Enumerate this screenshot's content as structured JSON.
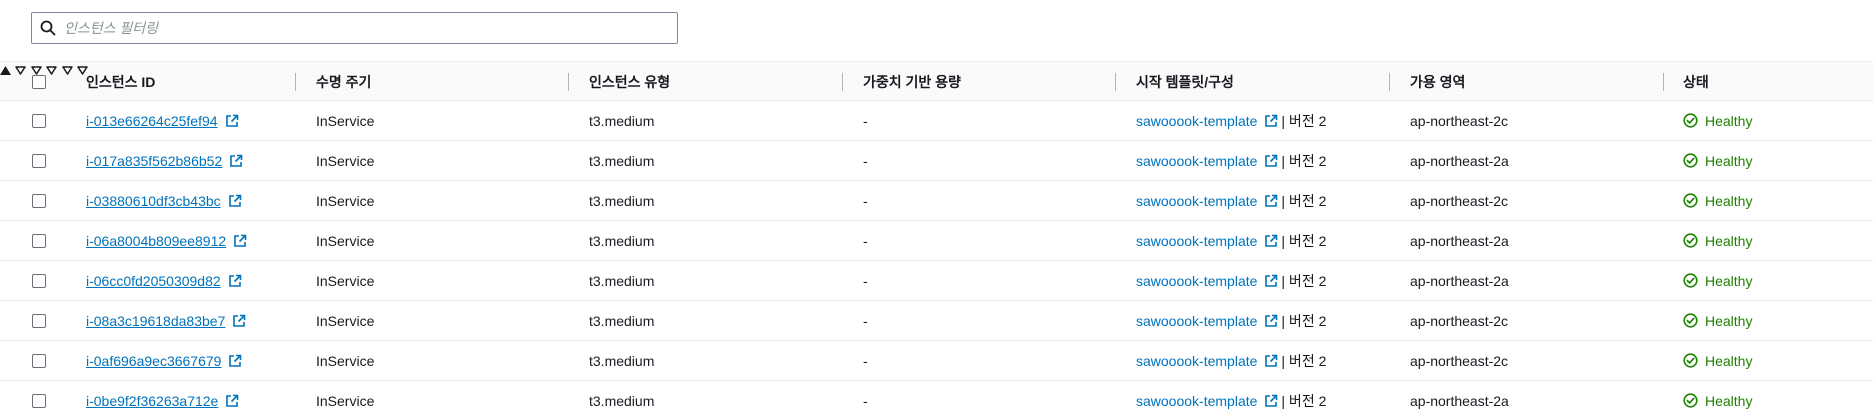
{
  "filter": {
    "placeholder": "인스턴스 필터링",
    "value": ""
  },
  "columns": [
    {
      "key": "id",
      "label": "인스턴스 ID",
      "sort": "ascending"
    },
    {
      "key": "lifecycle",
      "label": "수명 주기",
      "sort": "none"
    },
    {
      "key": "type",
      "label": "인스턴스 유형",
      "sort": "none"
    },
    {
      "key": "weight",
      "label": "가중치 기반 용량",
      "sort": "none"
    },
    {
      "key": "template",
      "label": "시작 템플릿/구성",
      "sort": "none"
    },
    {
      "key": "az",
      "label": "가용 영역",
      "sort": "none"
    },
    {
      "key": "health",
      "label": "상태",
      "sort": "none"
    }
  ],
  "rows": [
    {
      "id": "i-013e66264c25fef94",
      "lifecycle": "InService",
      "type": "t3.medium",
      "weight": "-",
      "template": "sawooook-template",
      "version": "| 버전 2",
      "az": "ap-northeast-2c",
      "health": "Healthy"
    },
    {
      "id": "i-017a835f562b86b52",
      "lifecycle": "InService",
      "type": "t3.medium",
      "weight": "-",
      "template": "sawooook-template",
      "version": "| 버전 2",
      "az": "ap-northeast-2a",
      "health": "Healthy"
    },
    {
      "id": "i-03880610df3cb43bc",
      "lifecycle": "InService",
      "type": "t3.medium",
      "weight": "-",
      "template": "sawooook-template",
      "version": "| 버전 2",
      "az": "ap-northeast-2c",
      "health": "Healthy"
    },
    {
      "id": "i-06a8004b809ee8912",
      "lifecycle": "InService",
      "type": "t3.medium",
      "weight": "-",
      "template": "sawooook-template",
      "version": "| 버전 2",
      "az": "ap-northeast-2a",
      "health": "Healthy"
    },
    {
      "id": "i-06cc0fd2050309d82",
      "lifecycle": "InService",
      "type": "t3.medium",
      "weight": "-",
      "template": "sawooook-template",
      "version": "| 버전 2",
      "az": "ap-northeast-2a",
      "health": "Healthy"
    },
    {
      "id": "i-08a3c19618da83be7",
      "lifecycle": "InService",
      "type": "t3.medium",
      "weight": "-",
      "template": "sawooook-template",
      "version": "| 버전 2",
      "az": "ap-northeast-2c",
      "health": "Healthy"
    },
    {
      "id": "i-0af696a9ec3667679",
      "lifecycle": "InService",
      "type": "t3.medium",
      "weight": "-",
      "template": "sawooook-template",
      "version": "| 버전 2",
      "az": "ap-northeast-2c",
      "health": "Healthy"
    },
    {
      "id": "i-0be9f2f36263a712e",
      "lifecycle": "InService",
      "type": "t3.medium",
      "weight": "-",
      "template": "sawooook-template",
      "version": "| 버전 2",
      "az": "ap-northeast-2a",
      "health": "Healthy"
    }
  ],
  "icons": {
    "search": "search-icon",
    "sort_asc": "sort-ascending-icon",
    "sort_none": "sort-unsorted-icon",
    "external": "external-link-icon",
    "healthy": "status-success-icon"
  },
  "colors": {
    "link": "#0073bb",
    "healthy": "#1d8102",
    "header_bg": "#fafafa",
    "border": "#eaeded"
  }
}
